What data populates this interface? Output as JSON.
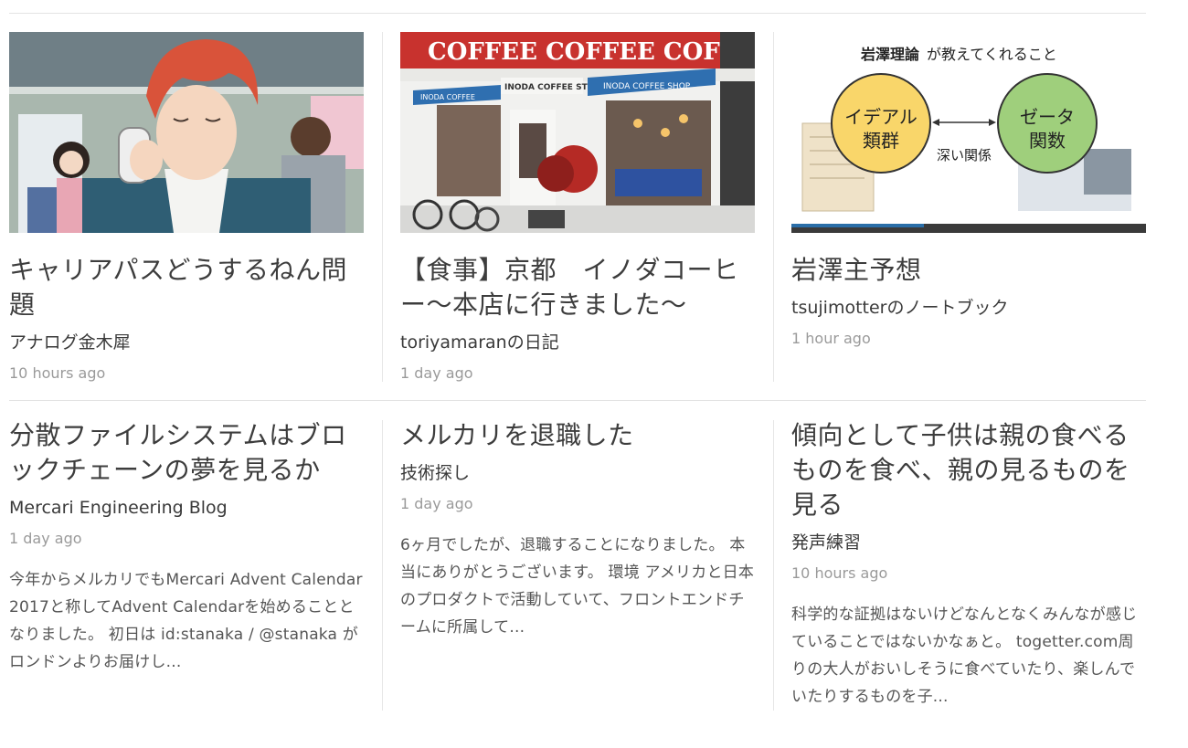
{
  "cards_row1": [
    {
      "title": "キャリアパスどうするねん問題",
      "blog": "アナログ金木犀",
      "time": "10 hours ago",
      "image": "anime-character-on-phone-thumbnail"
    },
    {
      "title": "【食事】京都　イノダコーヒー〜本店に行きました〜",
      "blog": "toriyamaranの日記",
      "time": "1 day ago",
      "image": "coffee-shop-storefront-thumbnail",
      "image_sign": "COFFEE COFFEE COFFEE",
      "image_awning_1": "INODA COFFEE STORE",
      "image_awning_2": "INODA COFFEE SHOP"
    },
    {
      "title": "岩澤主予想",
      "blog": "tsujimotterのノートブック",
      "time": "1 hour ago",
      "image": "slide-diagram-thumbnail",
      "slide_heading_bold": "岩澤理論",
      "slide_heading_rest": " が教えてくれること",
      "slide_left_circle_1": "イデアル",
      "slide_left_circle_2": "類群",
      "slide_right_circle_1": "ゼータ",
      "slide_right_circle_2": "関数",
      "slide_relation": "深い関係"
    }
  ],
  "cards_row2": [
    {
      "title": "分散ファイルシステムはブロックチェーンの夢を見るか",
      "blog": "Mercari Engineering Blog",
      "time": "1 day ago",
      "excerpt": "今年からメルカリでもMercari Advent Calendar 2017と称してAdvent Calendarを始めることとなりました。 初日は id:stanaka / @stanaka がロンドンよりお届けし..."
    },
    {
      "title": "メルカリを退職した",
      "blog": "技術探し",
      "time": "1 day ago",
      "excerpt": "6ヶ月でしたが、退職することになりました。 本当にありがとうございます。 環境 アメリカと日本のプロダクトで活動していて、フロントエンドチームに所属して..."
    },
    {
      "title": "傾向として子供は親の食べるものを食べ、親の見るものを見る",
      "blog": "発声練習",
      "time": "10 hours ago",
      "excerpt": "科学的な証拠はないけどなんとなくみんなが感じていることではないかなぁと。 togetter.com周りの大人がおいしそうに食べていたり、楽しんでいたりするものを子..."
    }
  ],
  "colors": {
    "slide_yellow": "#f9d66a",
    "slide_green": "#9fcf7c",
    "coffee_red": "#c8322e",
    "awning_blue": "#2f6fb0"
  }
}
